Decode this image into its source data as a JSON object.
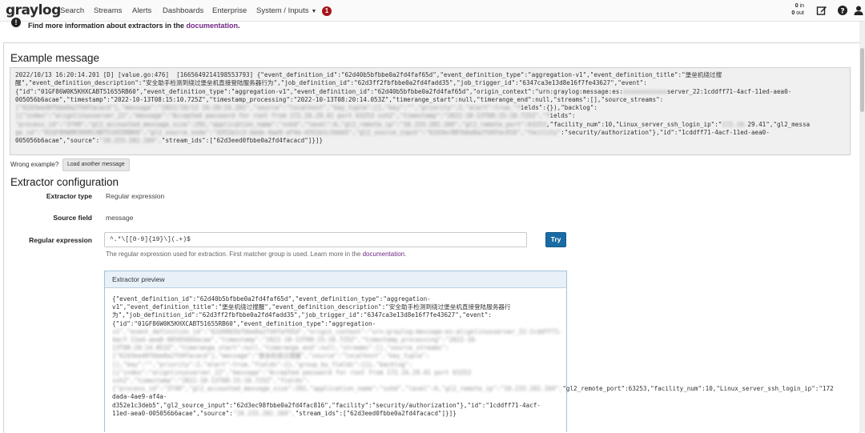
{
  "nav": {
    "logo": "graylog",
    "items": [
      "Search",
      "Streams",
      "Alerts",
      "Dashboards",
      "Enterprise"
    ],
    "system_label": "System / Inputs",
    "notification_count": "1",
    "throughput_in": "0",
    "throughput_in_label": "in",
    "throughput_out": "0",
    "throughput_out_label": "out",
    "icons": [
      "edit-icon",
      "help-icon",
      "user-icon"
    ]
  },
  "info": {
    "text": "Find more information about extractors in the",
    "link": "documentation",
    "suffix": "."
  },
  "example": {
    "title": "Example message",
    "lines": [
      "2022/10/13 16:20:14.201 [D] [value.go:476]  [1665649214198553793] {\"event_definition_id\":\"62d40b5bfbbe0a2fd4faf65d\",\"event_definition_type\":\"aggregation-v1\",\"event_definition_title\":\"堡垒机绕过搜",
      "醒\",\"event_definition_description\":\"安全助手检测到绕过堡垒机直接登陆服务器行为\",\"job_definition_id\":\"62d3ff2fbfbbe0a2fd4fadd35\",\"job_trigger_id\":\"6347ca3e13d8e16f7fe43627\",\"event\":",
      "{\"id\":\"01GF86W0K5KHXCABT51655RB60\",\"event_definition_type\":\"aggregation-v1\",\"event_definition_id\":\"62d40b5bfbbe0a2fd4faf65d\",\"origin_context\":\"urn:graylog:message:es:",
      "005056b6acae\",\"timestamp\":\"2022-10-13T08:15:10.725Z\",\"timestamp_processing\":\"2022-10-13T08:20:14.053Z\",\"timerange_start\":null,\"timerange_end\":null,\"streams\":[],\"source_streams\":",
      "",
      "",
      "",
      "",
      "005056b6acae\",\"source\":",
      ""
    ],
    "line2_tail": "server_22:1cddff71-4acf-11ed-aea0-",
    "line5_tail": "ields\":{}),\"backlog\":",
    "line6_tail": "ields\":",
    "line7_tail": ",\"facility_num\":10,\"Linux_server_ssh_login_ip\":\"",
    "line7_ip": "29.41\",\"gl2_messa",
    "line8_tail": ":\"security/authorization\"},\"id\":\"1cddff71-4acf-11ed-aea0-",
    "line9_tail": "\"stream_ids\":[\"62d3eed0fbbe0a2fd4facacd\"]}]}",
    "wrong_label": "Wrong example?",
    "load_button": "Load another message"
  },
  "config": {
    "title": "Extractor configuration",
    "extractor_type_label": "Extractor type",
    "extractor_type_value": "Regular expression",
    "source_field_label": "Source field",
    "source_field_value": "message",
    "regex_label": "Regular expression",
    "regex_value": "^.*\\[[0-9]{19}\\](.+)$",
    "try_button": "Try",
    "help_text": "The regular expression used for extraction. First matcher group is used. Learn more in the",
    "help_link": "documentation",
    "help_suffix": "."
  },
  "preview": {
    "title": "Extractor preview",
    "lines": [
      "{\"event_definition_id\":\"62d40b5bfbbe0a2fd4faf65d\",\"event_definition_type\":\"aggregation-",
      "v1\",\"event_definition_title\":\"堡垒机绕过搜醒\",\"event_definition_description\":\"安全助手检测到绕过堡垒机直接登陆服务器行",
      "为\",\"job_definition_id\":\"62d3ff2fbfbbe0a2fd4fadd35\",\"job_trigger_id\":\"6347ca3e13d8e16f7fe43627\",\"event\":",
      "{\"id\":\"01GF86W0K5KHXCABT51655RB60\",\"event_definition_type\":\"aggregation-"
    ],
    "line_port": "\"gl2_remote_port\":63253,\"facility_num\":10,\"Linux_server_ssh_login_ip\":\"172",
    "line_after": [
      "dada-4ae9-af4a-",
      "d352e1c3deb5\",\"gl2_source_input\":\"62d3ec98fbbe0a2fd4fac816\",\"facility\":\"security/authorization\"},\"id\":\"1cddff71-4acf-",
      "11ed-aea0-005056b6acae\",\"source\":"
    ],
    "line_last_tail": "\"stream_ids\":[\"62d3eed0fbbe0a2fd4facacd\"]}]}"
  },
  "colors": {
    "brand_link": "#702785",
    "primary_button": "#1a6ba3",
    "badge": "#a5141a",
    "preview_header": "#e8f1f8"
  }
}
